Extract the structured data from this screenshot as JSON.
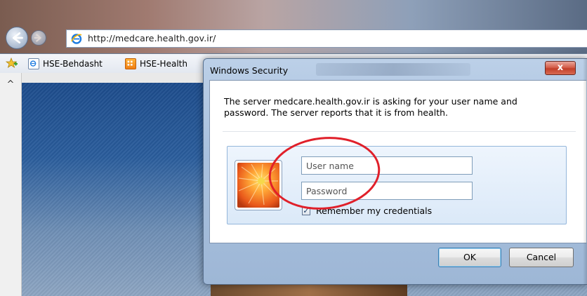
{
  "browser": {
    "address_url": "http://medcare.health.gov.ir/",
    "favorites": [
      {
        "label": "HSE-Behdasht",
        "icon": "ie-page-icon"
      },
      {
        "label": "HSE-Health",
        "icon": "orange-site-icon"
      }
    ]
  },
  "dialog": {
    "title": "Windows Security",
    "close_label": "x",
    "message": "The server medcare.health.gov.ir is asking for your user name and password. The server reports that it is from health.",
    "username_placeholder": "User name",
    "password_placeholder": "Password",
    "remember_label": "Remember my credentials",
    "remember_checked": true,
    "ok_label": "OK",
    "cancel_label": "Cancel"
  },
  "colors": {
    "annotation_ellipse": "#e0202a",
    "ok_focus_border": "#3c7fb1",
    "close_button": "#c2402a"
  }
}
